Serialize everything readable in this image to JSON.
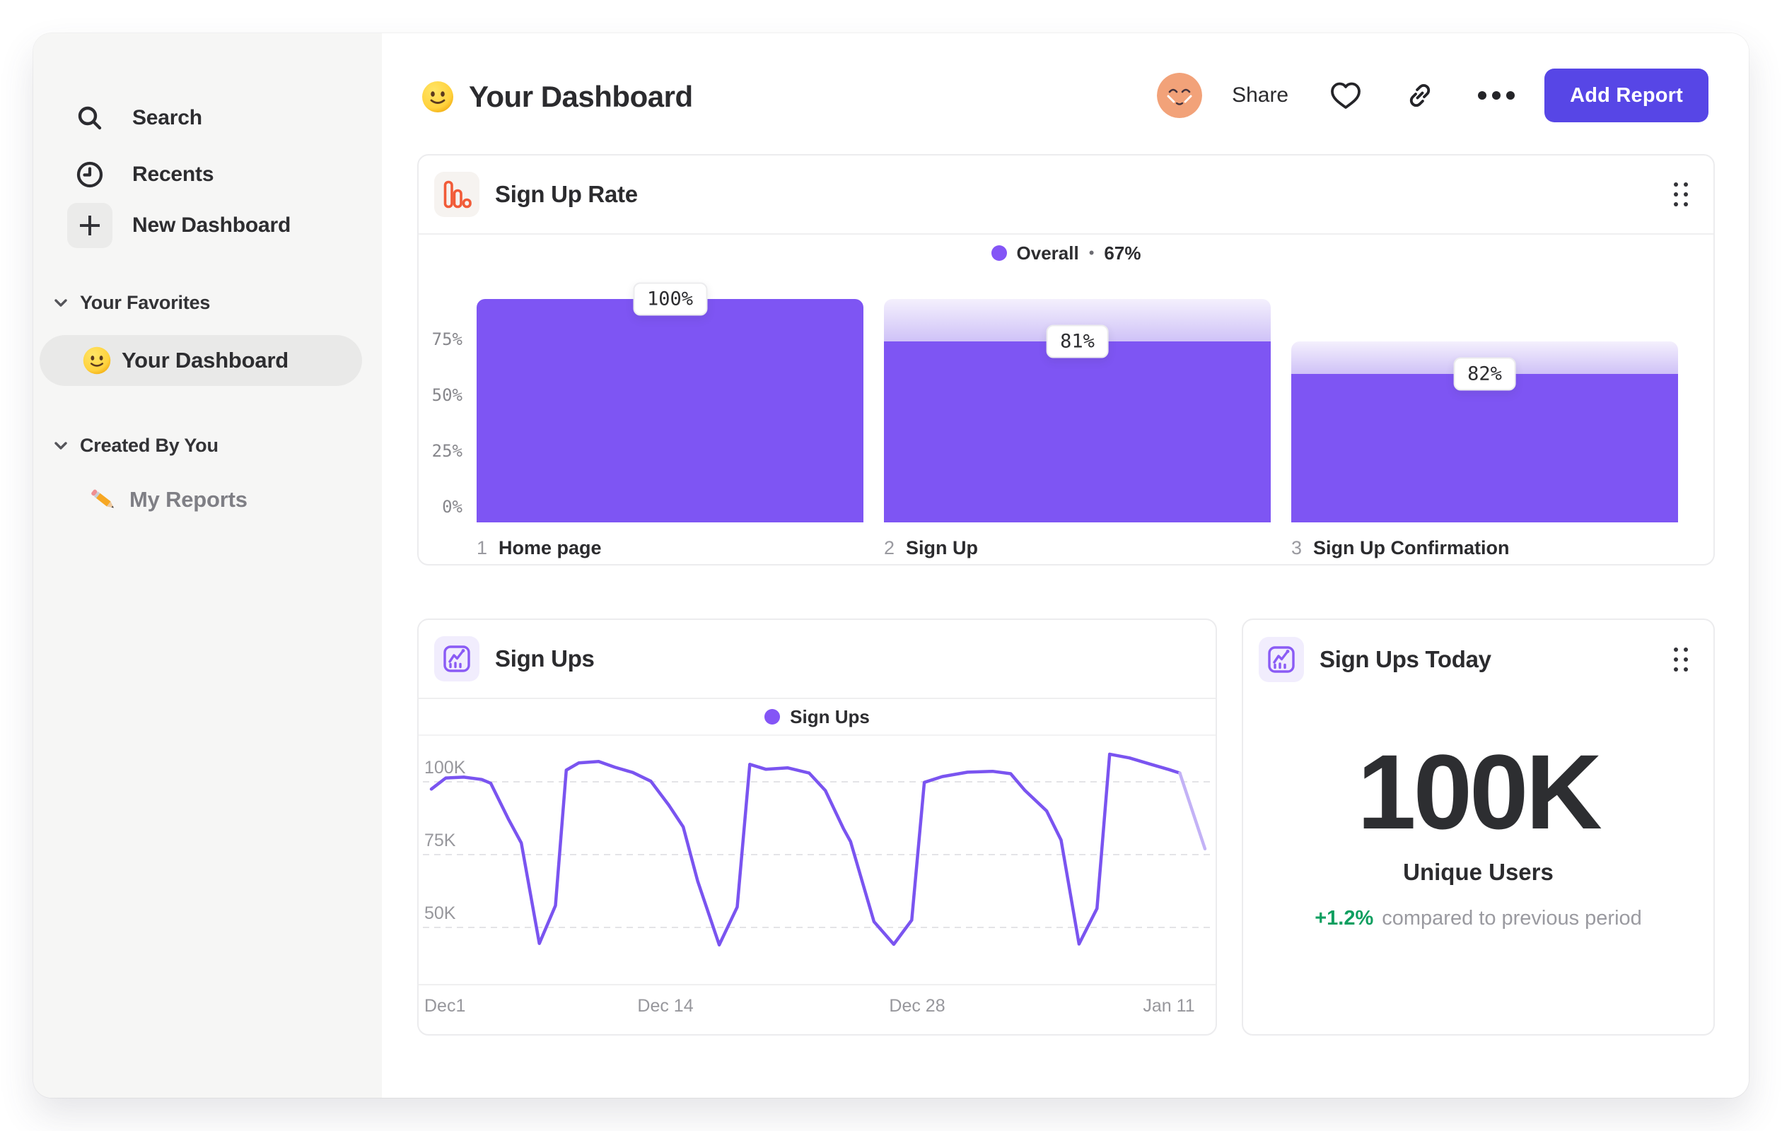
{
  "colors": {
    "accent_purple": "#7e55f3",
    "button_purple": "#5746e6",
    "legend_purple": "#8455f6",
    "forecast_purple": "#c3b2f6",
    "funnel_gradient_top": "#f4f0fd",
    "funnel_gradient_bottom": "#cfc2f7",
    "green": "#0f9f60",
    "icon_orange": "#f15b38",
    "icon_purple": "#8a5bf5"
  },
  "sidebar": {
    "items": [
      {
        "label": "Search"
      },
      {
        "label": "Recents"
      },
      {
        "label": "New Dashboard"
      }
    ],
    "sections": [
      {
        "title": "Your Favorites",
        "items": [
          {
            "label": "Your Dashboard",
            "selected": true
          }
        ]
      },
      {
        "title": "Created By You",
        "items": [
          {
            "label": "My Reports",
            "selected": false
          }
        ]
      }
    ]
  },
  "header": {
    "title": "Your Dashboard",
    "share_label": "Share",
    "add_report_label": "Add Report"
  },
  "cards": {
    "funnel": {
      "title": "Sign Up Rate"
    },
    "line": {
      "title": "Sign Ups"
    },
    "stat": {
      "title": "Sign Ups Today",
      "value": "100K",
      "label": "Unique Users",
      "delta": "+1.2%",
      "note": "compared to previous period"
    }
  },
  "chart_data": [
    {
      "type": "bar",
      "subtype": "funnel",
      "title": "Sign Up Rate",
      "legend": {
        "name": "Overall",
        "sep": "•",
        "value": "67%"
      },
      "overall_pct": 67,
      "yticks": [
        {
          "label": "75%",
          "frac": 0.75
        },
        {
          "label": "50%",
          "frac": 0.5
        },
        {
          "label": "25%",
          "frac": 0.25
        },
        {
          "label": "0%",
          "frac": 0.0
        }
      ],
      "steps": [
        {
          "index": "1",
          "label": "Home page",
          "start_pct": 100,
          "conversion_pct": 100,
          "badge": "100%"
        },
        {
          "index": "2",
          "label": "Sign Up",
          "start_pct": 100,
          "conversion_pct": 81,
          "badge": "81%"
        },
        {
          "index": "3",
          "label": "Sign Up Confirmation",
          "start_pct": 81,
          "conversion_pct": 82,
          "badge": "82%"
        }
      ]
    },
    {
      "type": "line",
      "title": "Sign Ups",
      "legend": "Sign Ups",
      "unit": "K",
      "ylim": [
        40,
        112
      ],
      "grid": "dashed-horizontal",
      "yticks": [
        {
          "label": "100K",
          "value": 100
        },
        {
          "label": "75K",
          "value": 75
        },
        {
          "label": "50K",
          "value": 50
        }
      ],
      "xticks": [
        {
          "label": "Dec1",
          "day": 0,
          "align": "left"
        },
        {
          "label": "Dec 14",
          "day": 13,
          "align": "center"
        },
        {
          "label": "Dec 28",
          "day": 27,
          "align": "center"
        },
        {
          "label": "Jan 11",
          "day": 41,
          "align": "center"
        }
      ],
      "points": [
        [
          0,
          97.5
        ],
        [
          0.8,
          101.3
        ],
        [
          1.8,
          101.6
        ],
        [
          2.8,
          100.8
        ],
        [
          3.3,
          99.5
        ],
        [
          4.3,
          87
        ],
        [
          5,
          79
        ],
        [
          6,
          44.5
        ],
        [
          6.9,
          57.5
        ],
        [
          7.5,
          104
        ],
        [
          8.2,
          106.5
        ],
        [
          9.3,
          107
        ],
        [
          10.2,
          105
        ],
        [
          11.2,
          103.2
        ],
        [
          12.2,
          100.2
        ],
        [
          13.2,
          92
        ],
        [
          14,
          84.5
        ],
        [
          14.8,
          66
        ],
        [
          16,
          44
        ],
        [
          17,
          57
        ],
        [
          17.7,
          106
        ],
        [
          18.6,
          104.3
        ],
        [
          19.8,
          104.8
        ],
        [
          21,
          103
        ],
        [
          21.9,
          97
        ],
        [
          22.9,
          84
        ],
        [
          23.3,
          79.5
        ],
        [
          24.6,
          52
        ],
        [
          25.7,
          44.2
        ],
        [
          26.7,
          52.5
        ],
        [
          27.4,
          99.8
        ],
        [
          28.4,
          101.8
        ],
        [
          29.8,
          103.3
        ],
        [
          31.2,
          103.6
        ],
        [
          32.2,
          102.8
        ],
        [
          33,
          97
        ],
        [
          34.2,
          90
        ],
        [
          35,
          80
        ],
        [
          36,
          44.3
        ],
        [
          37,
          56.5
        ],
        [
          37.7,
          109.5
        ],
        [
          38.8,
          108.2
        ],
        [
          40,
          106
        ],
        [
          41,
          104.2
        ],
        [
          41.6,
          103
        ],
        [
          43,
          77
        ]
      ],
      "forecast_from_index": 44
    },
    {
      "type": "stat",
      "title": "Sign Ups Today",
      "value": "100K",
      "label": "Unique Users",
      "delta": "+1.2%",
      "note": "compared to previous period"
    }
  ]
}
